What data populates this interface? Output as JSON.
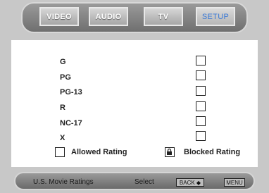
{
  "tabs": [
    {
      "label": "VIDEO",
      "active": false
    },
    {
      "label": "AUDIO",
      "active": false
    },
    {
      "label": "TV",
      "active": false
    },
    {
      "label": "SETUP",
      "active": true
    }
  ],
  "ratings": [
    {
      "label": "G",
      "blocked": false
    },
    {
      "label": "PG",
      "blocked": false
    },
    {
      "label": "PG-13",
      "blocked": false
    },
    {
      "label": "R",
      "blocked": false
    },
    {
      "label": "NC-17",
      "blocked": false
    },
    {
      "label": "X",
      "blocked": false
    }
  ],
  "legend": {
    "allowed_label": "Allowed Rating",
    "blocked_label": "Blocked Rating"
  },
  "footer": {
    "title": "U.S. Movie Ratings",
    "select_label": "Select",
    "select_key": "BACK ◆",
    "menu_key": "MENU"
  },
  "colors": {
    "accent": "#3a79d6",
    "frame": "#c8c8c8"
  }
}
